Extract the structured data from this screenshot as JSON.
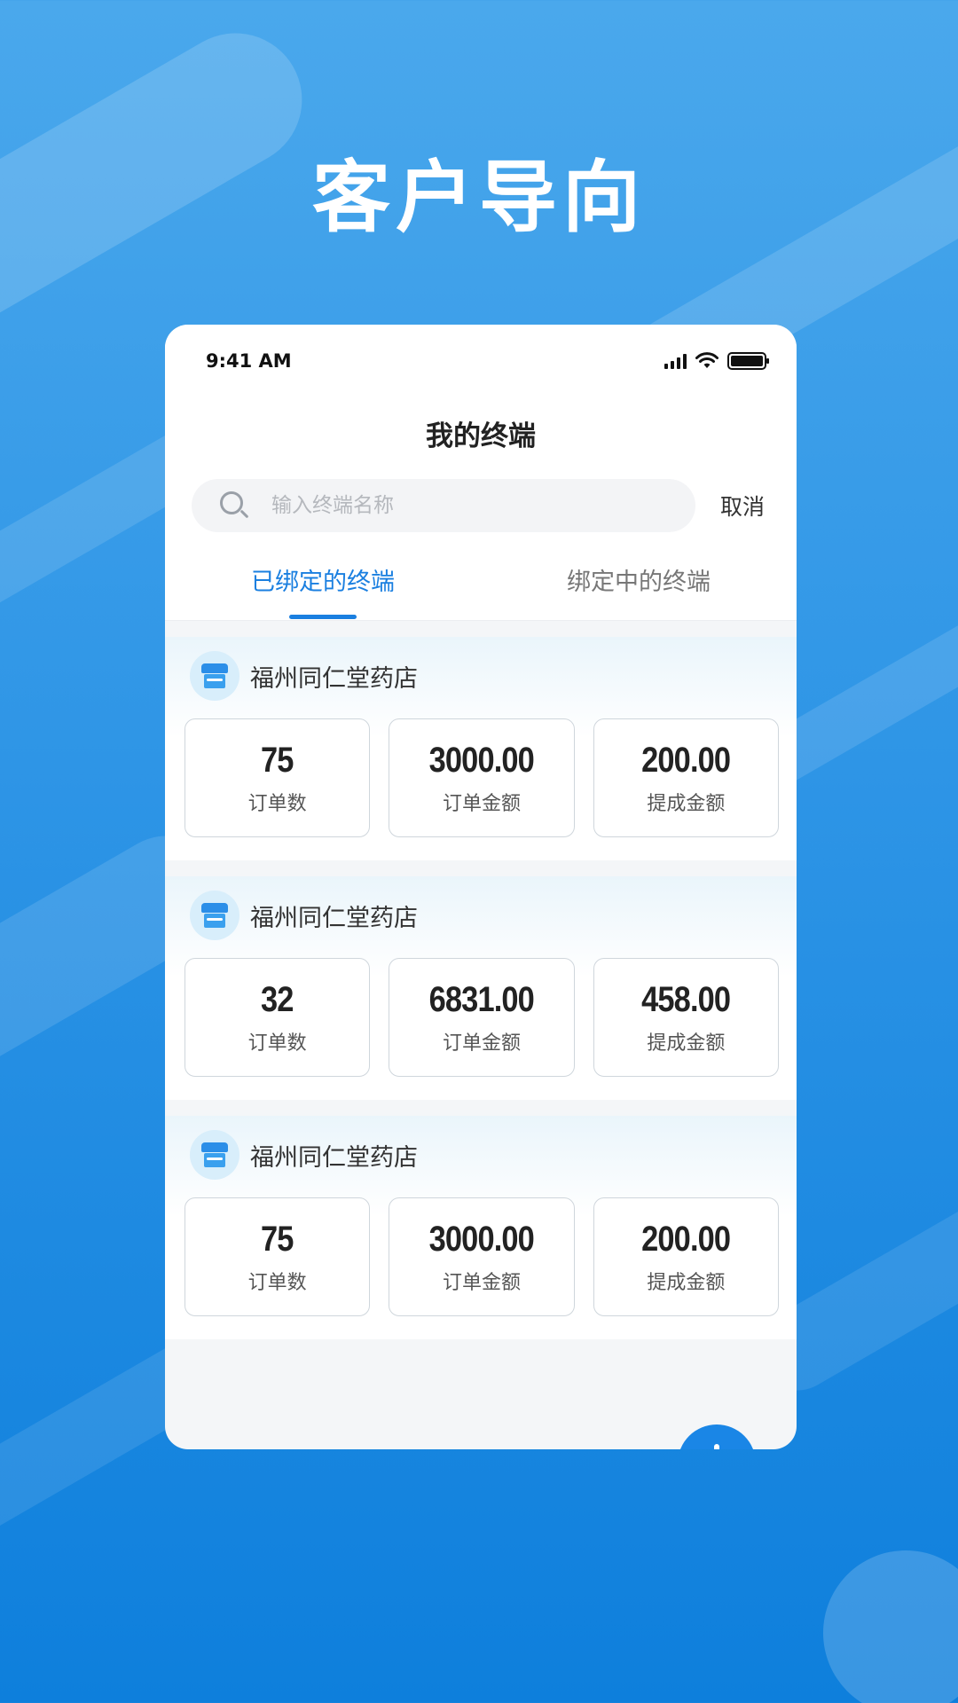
{
  "hero": {
    "title": "客户导向"
  },
  "status_bar": {
    "time": "9:41 AM",
    "icons": [
      "cellular-signal-icon",
      "wifi-icon",
      "battery-icon"
    ]
  },
  "nav": {
    "title": "我的终端"
  },
  "search": {
    "placeholder": "输入终端名称",
    "value": "",
    "cancel_label": "取消"
  },
  "tabs": [
    {
      "label": "已绑定的终端",
      "active": true
    },
    {
      "label": "绑定中的终端",
      "active": false
    }
  ],
  "stores": [
    {
      "name": "福州同仁堂药店",
      "stats": [
        {
          "value": "75",
          "label": "订单数"
        },
        {
          "value": "3000.00",
          "label": "订单金额"
        },
        {
          "value": "200.00",
          "label": "提成金额"
        }
      ]
    },
    {
      "name": "福州同仁堂药店",
      "stats": [
        {
          "value": "32",
          "label": "订单数"
        },
        {
          "value": "6831.00",
          "label": "订单金额"
        },
        {
          "value": "458.00",
          "label": "提成金额"
        }
      ]
    },
    {
      "name": "福州同仁堂药店",
      "stats": [
        {
          "value": "75",
          "label": "订单数"
        },
        {
          "value": "3000.00",
          "label": "订单金额"
        },
        {
          "value": "200.00",
          "label": "提成金额"
        }
      ]
    }
  ],
  "colors": {
    "accent": "#1a7fe0",
    "background_top": "#4aa8ec",
    "background_bottom": "#0e7fdc"
  }
}
